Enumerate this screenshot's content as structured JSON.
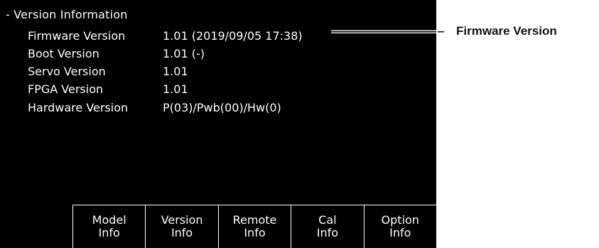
{
  "section": {
    "title": "- Version Information"
  },
  "rows": [
    {
      "label": "Firmware Version",
      "value": "1.01 (2019/09/05 17:38)"
    },
    {
      "label": "Boot Version",
      "value": "1.01 (-)"
    },
    {
      "label": "Servo Version",
      "value": "1.01"
    },
    {
      "label": "FPGA Version",
      "value": "1.01"
    },
    {
      "label": "Hardware Version",
      "value": "P(03)/Pwb(00)/Hw(0)"
    }
  ],
  "callout": {
    "label": "Firmware Version"
  },
  "softkeys": [
    {
      "line1": "Model",
      "line2": "Info"
    },
    {
      "line1": "Version",
      "line2": "Info"
    },
    {
      "line1": "Remote",
      "line2": "Info"
    },
    {
      "line1": "Cal",
      "line2": "Info"
    },
    {
      "line1": "Option",
      "line2": "Info"
    }
  ],
  "colors": {
    "screen_background": "#000000",
    "screen_text": "#ffffff",
    "callout_text": "#111111"
  }
}
